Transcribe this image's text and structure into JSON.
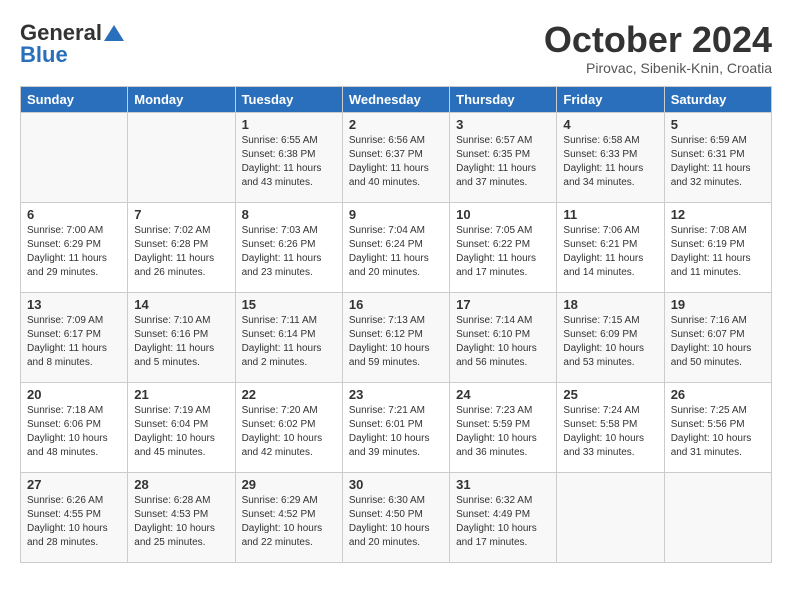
{
  "header": {
    "logo_general": "General",
    "logo_blue": "Blue",
    "title": "October 2024",
    "location": "Pirovac, Sibenik-Knin, Croatia"
  },
  "days_of_week": [
    "Sunday",
    "Monday",
    "Tuesday",
    "Wednesday",
    "Thursday",
    "Friday",
    "Saturday"
  ],
  "weeks": [
    [
      {
        "day": "",
        "info": ""
      },
      {
        "day": "",
        "info": ""
      },
      {
        "day": "1",
        "info": "Sunrise: 6:55 AM\nSunset: 6:38 PM\nDaylight: 11 hours and 43 minutes."
      },
      {
        "day": "2",
        "info": "Sunrise: 6:56 AM\nSunset: 6:37 PM\nDaylight: 11 hours and 40 minutes."
      },
      {
        "day": "3",
        "info": "Sunrise: 6:57 AM\nSunset: 6:35 PM\nDaylight: 11 hours and 37 minutes."
      },
      {
        "day": "4",
        "info": "Sunrise: 6:58 AM\nSunset: 6:33 PM\nDaylight: 11 hours and 34 minutes."
      },
      {
        "day": "5",
        "info": "Sunrise: 6:59 AM\nSunset: 6:31 PM\nDaylight: 11 hours and 32 minutes."
      }
    ],
    [
      {
        "day": "6",
        "info": "Sunrise: 7:00 AM\nSunset: 6:29 PM\nDaylight: 11 hours and 29 minutes."
      },
      {
        "day": "7",
        "info": "Sunrise: 7:02 AM\nSunset: 6:28 PM\nDaylight: 11 hours and 26 minutes."
      },
      {
        "day": "8",
        "info": "Sunrise: 7:03 AM\nSunset: 6:26 PM\nDaylight: 11 hours and 23 minutes."
      },
      {
        "day": "9",
        "info": "Sunrise: 7:04 AM\nSunset: 6:24 PM\nDaylight: 11 hours and 20 minutes."
      },
      {
        "day": "10",
        "info": "Sunrise: 7:05 AM\nSunset: 6:22 PM\nDaylight: 11 hours and 17 minutes."
      },
      {
        "day": "11",
        "info": "Sunrise: 7:06 AM\nSunset: 6:21 PM\nDaylight: 11 hours and 14 minutes."
      },
      {
        "day": "12",
        "info": "Sunrise: 7:08 AM\nSunset: 6:19 PM\nDaylight: 11 hours and 11 minutes."
      }
    ],
    [
      {
        "day": "13",
        "info": "Sunrise: 7:09 AM\nSunset: 6:17 PM\nDaylight: 11 hours and 8 minutes."
      },
      {
        "day": "14",
        "info": "Sunrise: 7:10 AM\nSunset: 6:16 PM\nDaylight: 11 hours and 5 minutes."
      },
      {
        "day": "15",
        "info": "Sunrise: 7:11 AM\nSunset: 6:14 PM\nDaylight: 11 hours and 2 minutes."
      },
      {
        "day": "16",
        "info": "Sunrise: 7:13 AM\nSunset: 6:12 PM\nDaylight: 10 hours and 59 minutes."
      },
      {
        "day": "17",
        "info": "Sunrise: 7:14 AM\nSunset: 6:10 PM\nDaylight: 10 hours and 56 minutes."
      },
      {
        "day": "18",
        "info": "Sunrise: 7:15 AM\nSunset: 6:09 PM\nDaylight: 10 hours and 53 minutes."
      },
      {
        "day": "19",
        "info": "Sunrise: 7:16 AM\nSunset: 6:07 PM\nDaylight: 10 hours and 50 minutes."
      }
    ],
    [
      {
        "day": "20",
        "info": "Sunrise: 7:18 AM\nSunset: 6:06 PM\nDaylight: 10 hours and 48 minutes."
      },
      {
        "day": "21",
        "info": "Sunrise: 7:19 AM\nSunset: 6:04 PM\nDaylight: 10 hours and 45 minutes."
      },
      {
        "day": "22",
        "info": "Sunrise: 7:20 AM\nSunset: 6:02 PM\nDaylight: 10 hours and 42 minutes."
      },
      {
        "day": "23",
        "info": "Sunrise: 7:21 AM\nSunset: 6:01 PM\nDaylight: 10 hours and 39 minutes."
      },
      {
        "day": "24",
        "info": "Sunrise: 7:23 AM\nSunset: 5:59 PM\nDaylight: 10 hours and 36 minutes."
      },
      {
        "day": "25",
        "info": "Sunrise: 7:24 AM\nSunset: 5:58 PM\nDaylight: 10 hours and 33 minutes."
      },
      {
        "day": "26",
        "info": "Sunrise: 7:25 AM\nSunset: 5:56 PM\nDaylight: 10 hours and 31 minutes."
      }
    ],
    [
      {
        "day": "27",
        "info": "Sunrise: 6:26 AM\nSunset: 4:55 PM\nDaylight: 10 hours and 28 minutes."
      },
      {
        "day": "28",
        "info": "Sunrise: 6:28 AM\nSunset: 4:53 PM\nDaylight: 10 hours and 25 minutes."
      },
      {
        "day": "29",
        "info": "Sunrise: 6:29 AM\nSunset: 4:52 PM\nDaylight: 10 hours and 22 minutes."
      },
      {
        "day": "30",
        "info": "Sunrise: 6:30 AM\nSunset: 4:50 PM\nDaylight: 10 hours and 20 minutes."
      },
      {
        "day": "31",
        "info": "Sunrise: 6:32 AM\nSunset: 4:49 PM\nDaylight: 10 hours and 17 minutes."
      },
      {
        "day": "",
        "info": ""
      },
      {
        "day": "",
        "info": ""
      }
    ]
  ]
}
